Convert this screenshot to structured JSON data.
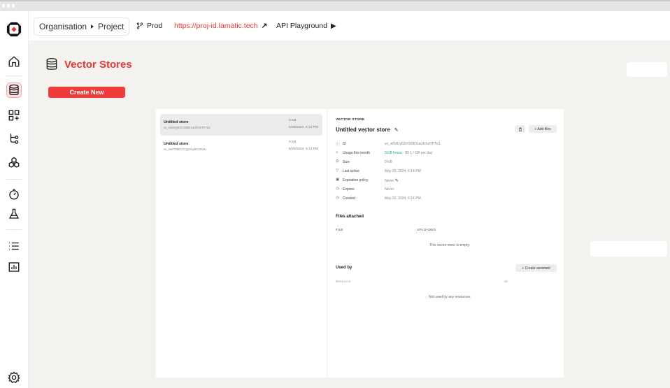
{
  "window": {
    "titlebar_dots": 3
  },
  "topbar": {
    "breadcrumb": {
      "org": "Organisation",
      "project": "Project"
    },
    "branch": "Prod",
    "url": "https://proj-id.lamatic.tech",
    "api_playground": "API Playground"
  },
  "sidebar": {
    "items": [
      {
        "name": "home",
        "icon": "home-icon",
        "active": false
      },
      {
        "name": "vector-stores",
        "icon": "database-icon",
        "active": true
      },
      {
        "name": "apps",
        "icon": "grid-plus-icon",
        "active": false
      },
      {
        "name": "flows",
        "icon": "flow-icon",
        "active": false
      },
      {
        "name": "models",
        "icon": "cubes-icon",
        "active": false
      },
      {
        "name": "monitoring",
        "icon": "gauge-icon",
        "active": false
      },
      {
        "name": "experiments",
        "icon": "flask-icon",
        "active": false
      },
      {
        "name": "logs",
        "icon": "list-icon",
        "active": false
      },
      {
        "name": "reports",
        "icon": "bar-chart-icon",
        "active": false
      },
      {
        "name": "settings",
        "icon": "gear-icon",
        "active": false
      }
    ]
  },
  "page": {
    "title": "Vector Stores",
    "create_label": "Create New"
  },
  "stores": [
    {
      "name": "Untitled store",
      "id": "vs_xKMUy63VO08D1aUfchdTPTd1",
      "size": "0 KB",
      "date": "5/20/2024, 6:14 PM",
      "selected": true
    },
    {
      "name": "Untitled store",
      "id": "vs_meFP8B7ACQpAby8CuRfkH",
      "size": "0 KB",
      "date": "5/20/2024, 6:14 PM",
      "selected": false
    }
  ],
  "detail": {
    "section_label": "VECTOR STORE",
    "title": "Untitled vector store",
    "add_files": "+ Add files",
    "rows": [
      {
        "icon": "info-icon",
        "label": "ID",
        "value": "vs_xKMUy63VO08D1aUfchdTPTd1"
      },
      {
        "icon": "usage-icon",
        "label": "Usage this month",
        "value_green": "0 KB hours",
        "value": " · $0.1 / GB per day"
      },
      {
        "icon": "size-icon",
        "label": "Size",
        "value": "0 KB"
      },
      {
        "icon": "activity-icon",
        "label": "Last active",
        "value": "May 20, 2024, 6:14 PM"
      },
      {
        "icon": "calendar-icon",
        "label": "Expiration policy",
        "value": "Never"
      },
      {
        "icon": "clock-icon",
        "label": "Expires",
        "value": "Never"
      },
      {
        "icon": "clock-icon",
        "label": "Created",
        "value": "May 20, 2024, 6:14 PM"
      }
    ],
    "files": {
      "title": "Files attached",
      "col_file": "FILE",
      "col_uploaded": "UPLOADED",
      "empty": "This vector store is empty."
    },
    "used_by": {
      "title": "Used by",
      "create_assistant": "+ Create assistant",
      "col_resource": "Resource",
      "col_id": "ID",
      "empty": "Not used by any resources"
    }
  }
}
